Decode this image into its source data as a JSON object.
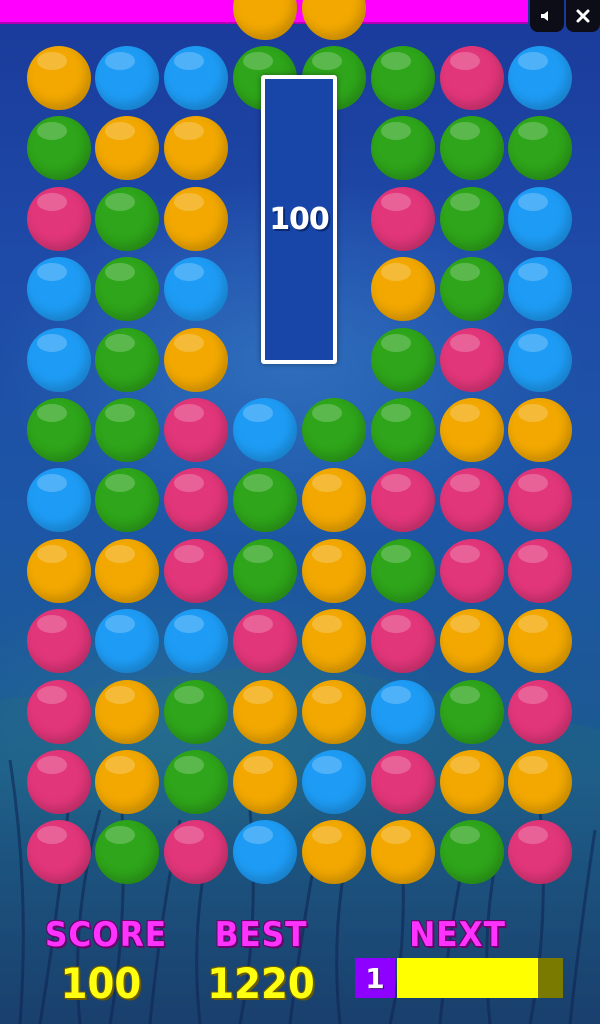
{
  "colors": {
    "orange": "#f2a800",
    "blue": "#1e9cf5",
    "green": "#2ea51a",
    "pink": "#e2367a",
    "topbar": "#ff00ff",
    "level_box": "#8e00ff",
    "level_fill": "#ffff00"
  },
  "top_falling_balls": [
    "orange",
    "orange"
  ],
  "grid": [
    [
      "orange",
      "blue",
      "blue",
      "green",
      "green",
      "green",
      "pink",
      "blue"
    ],
    [
      "green",
      "orange",
      "orange",
      null,
      null,
      "green",
      "green",
      "green"
    ],
    [
      "pink",
      "green",
      "orange",
      null,
      null,
      "pink",
      "green",
      "blue"
    ],
    [
      "blue",
      "green",
      "blue",
      null,
      null,
      "orange",
      "green",
      "blue"
    ],
    [
      "blue",
      "green",
      "orange",
      null,
      null,
      "green",
      "pink",
      "blue"
    ],
    [
      "green",
      "green",
      "pink",
      "blue",
      "green",
      "green",
      "orange",
      "orange"
    ],
    [
      "blue",
      "green",
      "pink",
      "green",
      "orange",
      "pink",
      "pink",
      "pink"
    ],
    [
      "orange",
      "orange",
      "pink",
      "green",
      "orange",
      "green",
      "pink",
      "pink"
    ],
    [
      "pink",
      "blue",
      "blue",
      "pink",
      "orange",
      "pink",
      "orange",
      "orange"
    ],
    [
      "pink",
      "orange",
      "green",
      "orange",
      "orange",
      "blue",
      "green",
      "pink"
    ],
    [
      "pink",
      "orange",
      "green",
      "orange",
      "blue",
      "pink",
      "orange",
      "orange"
    ],
    [
      "pink",
      "green",
      "pink",
      "blue",
      "orange",
      "orange",
      "green",
      "pink"
    ]
  ],
  "popup": {
    "points": "100"
  },
  "controls": {
    "sound_icon": "speaker-icon",
    "close_icon": "close-icon"
  },
  "hud": {
    "score_label": "SCORE",
    "score_value": "100",
    "best_label": "BEST",
    "best_value": "1220",
    "next_level_label": "NEXT LEVEL",
    "level_number": "1",
    "level_progress": 0.85
  }
}
